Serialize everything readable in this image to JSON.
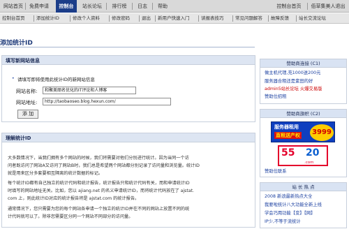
{
  "topnav": {
    "items": [
      "网站首页",
      "免费申请",
      "控制台",
      "站长论坛",
      "排行榜",
      "日志",
      "帮助"
    ],
    "right": [
      "控制台首页",
      "佰草集美人退出"
    ]
  },
  "subnav": {
    "items": [
      "控制台首页",
      "添加统计ID",
      "修改个人资料",
      "修改密码",
      "退出",
      "新用户快速入门",
      "读报表技巧",
      "常见问题解答",
      "故障反馈",
      "站长交流论坛"
    ]
  },
  "page": {
    "title": "添加统计ID"
  },
  "form_panel": {
    "header": "填写新网站信息",
    "notice": "请填写即将使用此统计ID的新网站信息",
    "site_name_label": "网站名称:",
    "site_name_value": "和聚美丽名优化的IT评论和人博客",
    "site_url_label": "网站地址:",
    "site_url_value": "http://taobaoseo.blog.hexun.com/",
    "add_button": "添 加"
  },
  "explain_panel": {
    "header": "理解统计ID",
    "p1": [
      "大多数情况下，当我们拥有多个网站的时候，我们将需要对他们分别进行统计。因为当同一个访",
      "问者既访问了网站A又访问了网站B时，我们总是希望两个网站都分别记录了访问量和浏览量。统计ID",
      "就是用来区分多套要相互隔离的统计数据的标记。"
    ],
    "p2": [
      "每个统计ID都有自己独立的统计代码和统计报告，统计报告只和统计代码有关，而和申请统计ID",
      "时填写的网站地址无关。比如，您以 ajiang.net 的名义申请统计ID，而将统计代码放在了 ajstat.",
      "com 上，则此统计ID对应的统计报告将是 ajstat.com 的统计报告。"
    ],
    "p3": [
      "通常情况下，您只需要为您的每个网站各申请一个独立的统计ID并在不同的网站上放置不同的统",
      "计代码就可以了。除非您需要区分同一个网站不同部分的访问量。"
    ]
  },
  "sidebar": {
    "box1": {
      "title": "赞助商连接 (C1)",
      "lines": [
        "做主机代理,充1000送200元",
        "服务器合租还是紫田的好",
        "admin5站长论坛 火爆交易版",
        "赞助位招租"
      ]
    },
    "box2": {
      "title": "赞助商旗帜 (C2)",
      "ad1_line1": "服务器租用",
      "ad1_line2": "直租送产权",
      "ad1_price": "3999",
      "ad2_left": "55",
      "ad2_right": "20",
      "ad2_com": ".com",
      "link": "赞助位联系"
    },
    "box3": {
      "title": "站 长 热 点",
      "lines": [
        "2008 新浪最新热点大全",
        "我要啦统计八大功能全新上线",
        "学会巧用功能【变】【网】",
        "IP少,不等于流统计"
      ]
    }
  },
  "colors": {
    "nav_active": "#1b3d89",
    "link": "#1a3fa0",
    "panel_head": "#dde5f2",
    "ad_red": "#e4002b"
  }
}
